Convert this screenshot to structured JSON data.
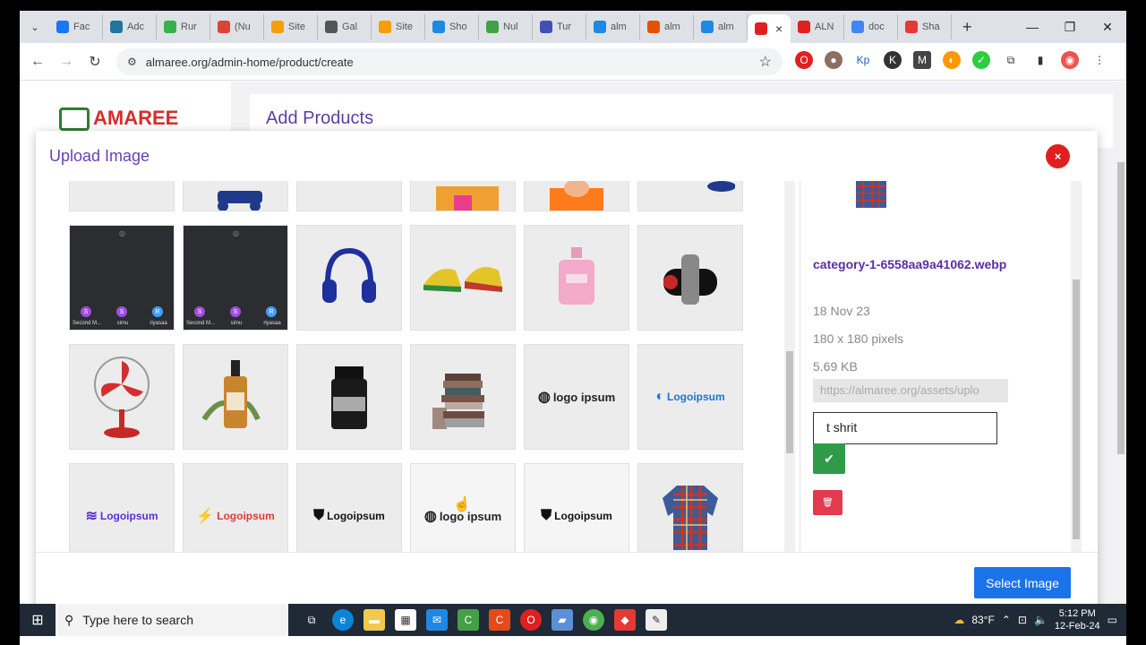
{
  "browser": {
    "tabs": [
      {
        "label": "Fac",
        "color": "#1877f2"
      },
      {
        "label": "Adc",
        "color": "#21759b"
      },
      {
        "label": "Rur",
        "color": "#35b34a"
      },
      {
        "label": "(Nu",
        "color": "#db4437"
      },
      {
        "label": "Site",
        "color": "#f59e0b"
      },
      {
        "label": "Gal",
        "color": "#555555"
      },
      {
        "label": "Site",
        "color": "#f59e0b"
      },
      {
        "label": "Sho",
        "color": "#1e88e5"
      },
      {
        "label": "Nul",
        "color": "#43a047"
      },
      {
        "label": "Tur",
        "color": "#3f51b5"
      },
      {
        "label": "alm",
        "color": "#1e88e5"
      },
      {
        "label": "alm",
        "color": "#e65100"
      },
      {
        "label": "alm",
        "color": "#1e88e5"
      }
    ],
    "active_tab_close": "×",
    "tabs_after": [
      {
        "label": "ALN",
        "color": "#e02020"
      },
      {
        "label": "doc",
        "color": "#4285f4"
      },
      {
        "label": "Sha",
        "color": "#e53935"
      }
    ],
    "new_tab": "+",
    "url": "almaree.org/admin-home/product/create"
  },
  "page": {
    "logo_text": "AMAREE",
    "header_title": "Add Products"
  },
  "modal": {
    "title": "Upload Image",
    "close_label": "×",
    "grid_images": [
      {
        "icon": "partial-item-icon",
        "dark": false
      },
      {
        "icon": "truck-icon",
        "dark": false
      },
      {
        "icon": "blank-icon",
        "dark": false
      },
      {
        "icon": "shopping-bags-icon",
        "dark": false
      },
      {
        "icon": "person-orange-icon",
        "dark": false
      },
      {
        "icon": "partial-blue-icon",
        "dark": false
      },
      {
        "icon": "video-call-screenshot-icon",
        "dark": true,
        "names": [
          "Second M...",
          "simu",
          "riyasaa"
        ]
      },
      {
        "icon": "video-call-screenshot-icon",
        "dark": true,
        "names": [
          "Second M...",
          "simu",
          "riyasaa"
        ]
      },
      {
        "icon": "headphones-icon",
        "dark": false
      },
      {
        "icon": "sneakers-icon",
        "dark": false
      },
      {
        "icon": "perfume-bottle-icon",
        "dark": false
      },
      {
        "icon": "speaker-icon",
        "dark": false
      },
      {
        "icon": "fan-icon",
        "dark": false
      },
      {
        "icon": "serum-bottle-icon",
        "dark": false
      },
      {
        "icon": "supplement-jar-icon",
        "dark": false
      },
      {
        "icon": "books-stack-icon",
        "dark": false
      },
      {
        "icon": "logo-ipsum-icon",
        "dark": false,
        "text": "logo ipsum"
      },
      {
        "icon": "logoipsum-blue-icon",
        "dark": false,
        "text": "Logoipsum"
      },
      {
        "icon": "logoipsum-purple-icon",
        "dark": false,
        "text": "Logoipsum"
      },
      {
        "icon": "logoipsum-red-icon",
        "dark": false,
        "text": "Logoipsum"
      },
      {
        "icon": "logoipsum-shield-icon",
        "dark": false,
        "text": "Logoipsum"
      },
      {
        "icon": "logo-ipsum-icon",
        "dark": false,
        "text": "logo ipsum"
      },
      {
        "icon": "logoipsum-shield-icon",
        "dark": false,
        "text": "Logoipsum"
      },
      {
        "icon": "flannel-shirt-icon",
        "dark": false
      }
    ],
    "details": {
      "filename": "category-1-6558aa9a41062.webp",
      "date": "18 Nov 23",
      "dimensions": "180 x 180 pixels",
      "size": "5.69 KB",
      "url": "https://almaree.org/assets/uplo",
      "alt_text": "t shrit"
    },
    "select_button": "Select Image"
  },
  "taskbar": {
    "search_placeholder": "Type here to search",
    "weather": "83°F",
    "time": "5:12 PM",
    "date": "12-Feb-24"
  },
  "colors": {
    "accent_purple": "#5b3ea6",
    "close_red": "#e02020",
    "select_blue": "#1a73e8",
    "confirm_green": "#2e9a4a",
    "delete_red": "#e23a4e"
  }
}
